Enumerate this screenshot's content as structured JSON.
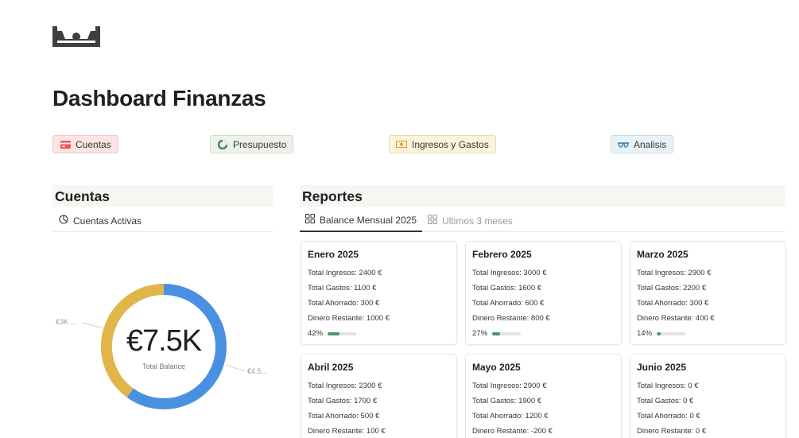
{
  "page": {
    "title": "Dashboard Finanzas"
  },
  "nav": [
    {
      "label": "Cuentas",
      "icon": "credit-card-icon",
      "color": "#eb5757"
    },
    {
      "label": "Presupuesto",
      "icon": "pie-chart-icon",
      "color": "#448361"
    },
    {
      "label": "Ingresos y Gastos",
      "icon": "money-bill-icon",
      "color": "#d9a52c"
    },
    {
      "label": "Analisis",
      "icon": "glasses-icon",
      "color": "#3a7ab5"
    }
  ],
  "cuentas": {
    "heading": "Cuentas",
    "view_label": "Cuentas Activas",
    "total_value": "€7.5K",
    "total_label": "Total Balance",
    "segments": [
      {
        "label": "€3K ...",
        "fraction": 0.4,
        "color": "#e0b54a"
      },
      {
        "label": "€4.5...",
        "fraction": 0.6,
        "color": "#4a90e2"
      }
    ]
  },
  "reportes": {
    "heading": "Reportes",
    "tabs": [
      {
        "label": "Balance Mensual 2025",
        "active": true
      },
      {
        "label": "Ultimos 3 meses",
        "active": false
      }
    ],
    "cards": [
      {
        "title": "Enero 2025",
        "ingresos": "Total Ingresos: 2400 €",
        "gastos": "Total Gastos: 1100 €",
        "ahorrado": "Total Ahorrado: 300 €",
        "restante": "Dinero Restante: 1000 €",
        "percent": "42%",
        "progress": 0.42
      },
      {
        "title": "Febrero 2025",
        "ingresos": "Total Ingresos: 3000 €",
        "gastos": "Total Gastos: 1600 €",
        "ahorrado": "Total Ahorrado: 600 €",
        "restante": "Dinero Restante: 800 €",
        "percent": "27%",
        "progress": 0.27
      },
      {
        "title": "Marzo 2025",
        "ingresos": "Total Ingresos: 2900 €",
        "gastos": "Total Gastos: 2200 €",
        "ahorrado": "Total Ahorrado: 300 €",
        "restante": "Dinero Restante: 400 €",
        "percent": "14%",
        "progress": 0.14
      },
      {
        "title": "Abril 2025",
        "ingresos": "Total Ingresos: 2300 €",
        "gastos": "Total Gastos: 1700 €",
        "ahorrado": "Total Ahorrado: 500 €",
        "restante": "Dinero Restante: 100 €"
      },
      {
        "title": "Mayo 2025",
        "ingresos": "Total Ingresos: 2900 €",
        "gastos": "Total Gastos: 1900 €",
        "ahorrado": "Total Ahorrado: 1200 €",
        "restante": "Dinero Restante: -200 €"
      },
      {
        "title": "Junio 2025",
        "ingresos": "Total Ingresos: 0 €",
        "gastos": "Total Gastos: 0 €",
        "ahorrado": "Total Ahorrado: 0 €",
        "restante": "Dinero Restante: 0 €"
      }
    ]
  }
}
